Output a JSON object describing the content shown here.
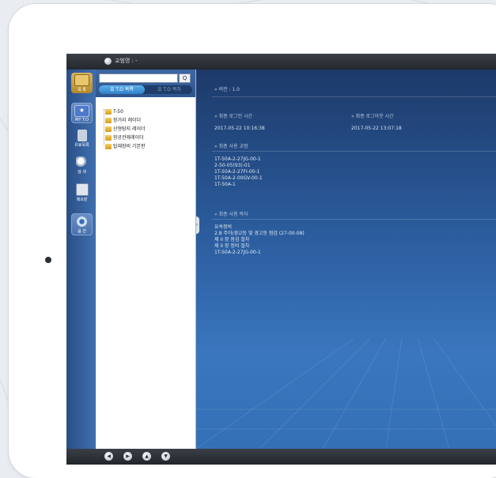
{
  "app": {
    "title": "교범명 : -"
  },
  "nav": [
    {
      "label": "목 록",
      "icon": "folder-icon",
      "active": true
    },
    {
      "label": "MY T.O",
      "icon": "star-icon",
      "active": false
    },
    {
      "label": "유효목록",
      "icon": "document-icon",
      "active": false
    },
    {
      "label": "검 색",
      "icon": "magnifier-icon",
      "active": false
    },
    {
      "label": "메모장",
      "icon": "memo-icon",
      "active": false
    },
    {
      "label": "옵 션",
      "icon": "gear-icon",
      "active": false
    }
  ],
  "tree_panel": {
    "search_value": "",
    "search_button": "Q",
    "tab_active": "☰ T.O 목록",
    "tab_inactive": "☰ T.O 목차",
    "items": [
      "T-50",
      "장거리 레이더",
      "산형탐지 레이더",
      "항공관제레이더",
      "탑재장비 기본판"
    ]
  },
  "main": {
    "version": "» 버전 : 1.0",
    "last_login_label": "» 최종 로그인 시간",
    "last_logout_label": "» 최종 로그아웃 시간",
    "last_login": "2017-05-22 10:16:38",
    "last_logout": "2017-05-22 13:07:18",
    "recent_manual_label": "» 최종 사용 교범",
    "recent_manuals": [
      "1T-50A-2-27JG-00-1",
      "2-50-05(93)-01",
      "1T-50A-2-27FI-00-1",
      "1T-50A-2-00GV-00-1",
      "1T-50A-1"
    ],
    "recent_toc_label": "» 최종 사용 목차",
    "recent_toc": [
      "유속정비",
      "2.8 주야/경교등 및 경고등 점검 (27-00-08)",
      "제 II 장 점검 절차",
      "제 II 장 정비 절차",
      "1T-50A-2-27JG-00-1"
    ]
  },
  "bottom_controls": [
    "◀",
    "▶",
    "▲",
    "▼"
  ]
}
